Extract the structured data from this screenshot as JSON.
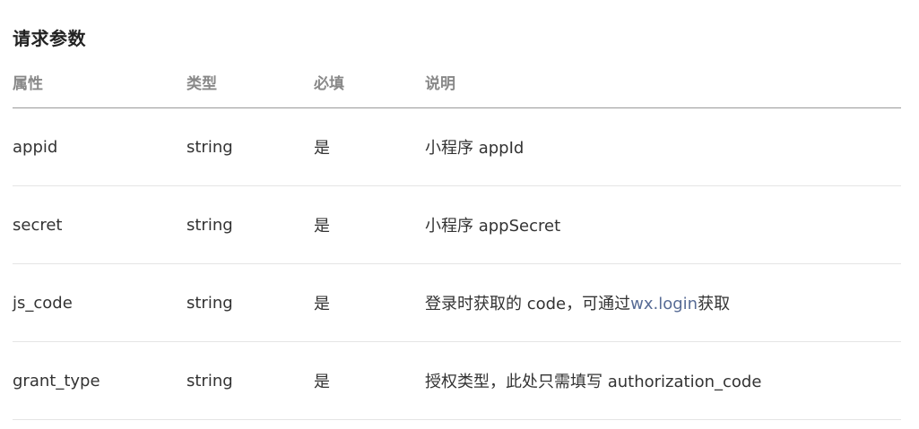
{
  "title": "请求参数",
  "headers": {
    "name": "属性",
    "type": "类型",
    "required": "必填",
    "description": "说明"
  },
  "rows": [
    {
      "name": "appid",
      "type": "string",
      "required": "是",
      "description_before": "小程序 appId",
      "link_text": "",
      "description_after": ""
    },
    {
      "name": "secret",
      "type": "string",
      "required": "是",
      "description_before": "小程序 appSecret",
      "link_text": "",
      "description_after": ""
    },
    {
      "name": "js_code",
      "type": "string",
      "required": "是",
      "description_before": "登录时获取的 code，可通过",
      "link_text": "wx.login",
      "description_after": "获取"
    },
    {
      "name": "grant_type",
      "type": "string",
      "required": "是",
      "description_before": "授权类型，此处只需填写 authorization_code",
      "link_text": "",
      "description_after": ""
    }
  ],
  "colors": {
    "link": "#576b95",
    "header_text": "#888888",
    "body_text": "#333333"
  }
}
